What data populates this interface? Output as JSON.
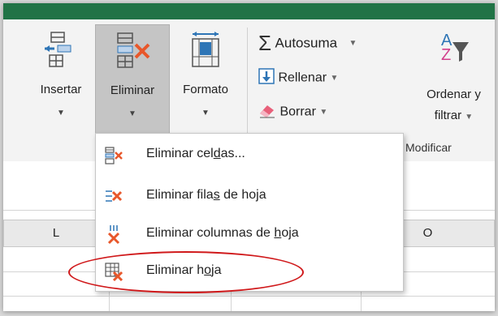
{
  "ribbon": {
    "insert": {
      "label": "Insertar"
    },
    "delete": {
      "label": "Eliminar"
    },
    "format": {
      "label": "Formato"
    },
    "autosum": {
      "label": "Autosuma"
    },
    "fill": {
      "label": "Rellenar"
    },
    "clear": {
      "label": "Borrar"
    },
    "sort": {
      "line1": "Ordenar y",
      "line2": "filtrar"
    },
    "group_label": "Modificar"
  },
  "menu": {
    "items": [
      {
        "label_pre": "Eliminar cel",
        "label_ul": "d",
        "label_post": "as...",
        "icon": "delete-cells-icon"
      },
      {
        "label_pre": "Eliminar fila",
        "label_ul": "s",
        "label_post": " de hoja",
        "icon": "delete-rows-icon"
      },
      {
        "label_pre": "Eliminar columnas de ",
        "label_ul": "h",
        "label_post": "oja",
        "icon": "delete-columns-icon"
      },
      {
        "label_pre": "Eliminar h",
        "label_ul": "o",
        "label_post": "ja",
        "icon": "delete-sheet-icon"
      }
    ]
  },
  "sheet": {
    "col_l": "L",
    "col_o": "O"
  },
  "colors": {
    "title_bar": "#217346",
    "highlight_oval": "#d0191b",
    "delete_x": "#e8572b"
  }
}
